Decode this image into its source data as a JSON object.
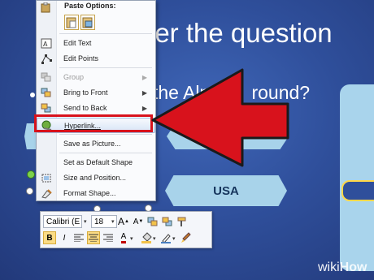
{
  "slide": {
    "title": "swer the question",
    "question": "the Alp",
    "question_suffix": "round?",
    "option_usa": "USA"
  },
  "context_menu": {
    "paste_header": "Paste Options:",
    "items": [
      {
        "label": "Edit Text",
        "enabled": true,
        "icon": "edit-text-icon"
      },
      {
        "label": "Edit Points",
        "enabled": true,
        "icon": "edit-points-icon"
      },
      {
        "label": "Group",
        "enabled": false,
        "submenu": true,
        "icon": "group-icon"
      },
      {
        "label": "Bring to Front",
        "enabled": true,
        "submenu": true,
        "icon": "bring-front-icon"
      },
      {
        "label": "Send to Back",
        "enabled": true,
        "submenu": true,
        "icon": "send-back-icon"
      },
      {
        "label": "Hyperlink...",
        "enabled": true,
        "highlighted": true,
        "icon": "hyperlink-globe-icon"
      },
      {
        "label": "Save as Picture...",
        "enabled": true
      },
      {
        "label": "Set as Default Shape",
        "enabled": true
      },
      {
        "label": "Size and Position...",
        "enabled": true,
        "icon": "size-position-icon"
      },
      {
        "label": "Format Shape...",
        "enabled": true,
        "icon": "format-shape-icon"
      }
    ],
    "submenu_glyph": "▶"
  },
  "mini_toolbar": {
    "font_name": "Calibri (E",
    "font_size": "18",
    "grow_font": "A",
    "shrink_font": "A",
    "bold": "B",
    "italic": "I",
    "font_color_letter": "A",
    "dropdown_glyph": "▾"
  },
  "annotation": {
    "arrow_color": "#d8121c",
    "highlight_color": "#d8121c"
  },
  "watermark": {
    "brand_light": "wiki",
    "brand_bold": "How"
  }
}
